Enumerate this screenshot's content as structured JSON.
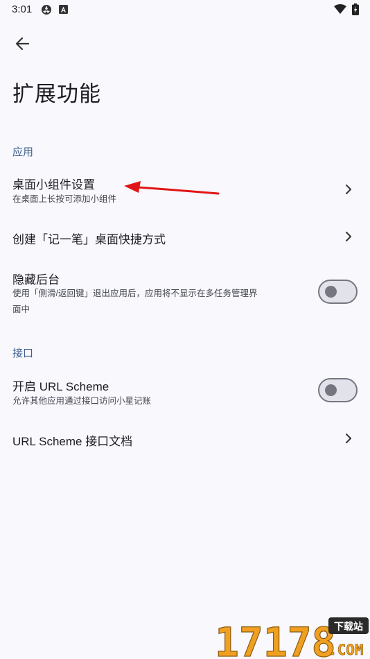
{
  "status_bar": {
    "time": "3:01",
    "icons": [
      "app-notification-icon",
      "accessibility-icon",
      "wifi-icon",
      "battery-charging-icon"
    ]
  },
  "header": {
    "back_icon": "arrow-left-icon",
    "title": "扩展功能"
  },
  "sections": [
    {
      "header": "应用",
      "items": [
        {
          "title": "桌面小组件设置",
          "subtitle": "在桌面上长按可添加小组件",
          "control": "chevron"
        },
        {
          "title": "创建「记一笔」桌面快捷方式",
          "subtitle": "",
          "control": "chevron"
        },
        {
          "title": "隐藏后台",
          "subtitle_line1": "使用「侧滑/返回键」退出应用后，应用将不显示在多任务管理界",
          "subtitle_line2": "面中",
          "control": "toggle",
          "checked": false
        }
      ]
    },
    {
      "header": "接口",
      "items": [
        {
          "title": "开启 URL Scheme",
          "subtitle": "允许其他应用通过接口访问小星记账",
          "control": "toggle",
          "checked": false
        },
        {
          "title": "URL Scheme 接口文档",
          "subtitle": "",
          "control": "chevron"
        }
      ]
    }
  ],
  "watermark": {
    "digits": "17178",
    "tag": "下载站",
    "suffix": ".COM"
  },
  "colors": {
    "background": "#f8f8fd",
    "section_header": "#3f5f8f",
    "toggle_outline": "#757680",
    "annotation_arrow": "#e01515",
    "watermark_orange": "#f0a020"
  }
}
